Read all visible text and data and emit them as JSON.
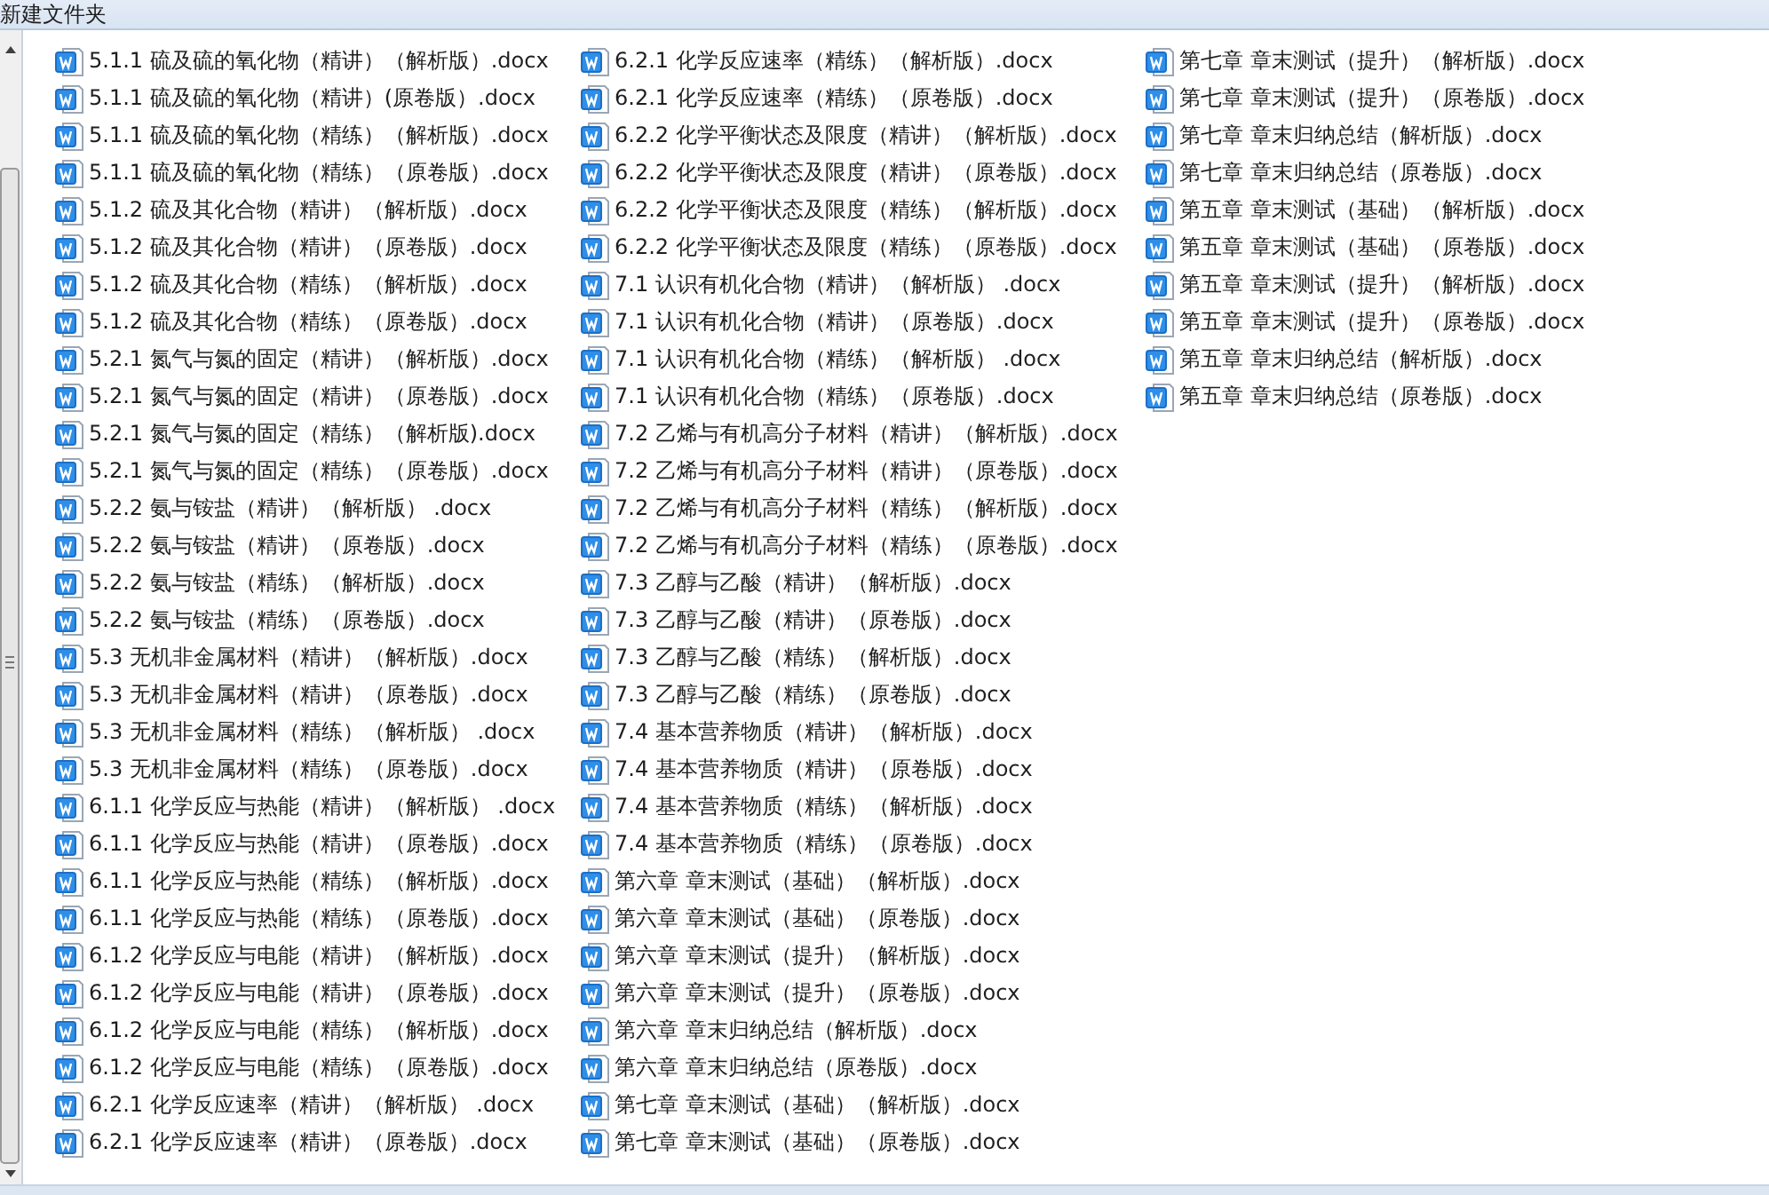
{
  "window": {
    "title": "新建文件夹"
  },
  "files": [
    {
      "name": "5.1.1 硫及硫的氧化物（精讲）（解析版）.docx"
    },
    {
      "name": "5.1.1 硫及硫的氧化物（精讲）(原卷版）.docx"
    },
    {
      "name": "5.1.1 硫及硫的氧化物（精练）（解析版）.docx"
    },
    {
      "name": "5.1.1 硫及硫的氧化物（精练）（原卷版）.docx"
    },
    {
      "name": "5.1.2 硫及其化合物（精讲）（解析版）.docx"
    },
    {
      "name": "5.1.2 硫及其化合物（精讲）（原卷版）.docx"
    },
    {
      "name": "5.1.2 硫及其化合物（精练）（解析版）.docx"
    },
    {
      "name": "5.1.2 硫及其化合物（精练）（原卷版）.docx"
    },
    {
      "name": "5.2.1 氮气与氮的固定（精讲）（解析版）.docx"
    },
    {
      "name": "5.2.1 氮气与氮的固定（精讲）（原卷版）.docx"
    },
    {
      "name": "5.2.1 氮气与氮的固定（精练）（解析版).docx"
    },
    {
      "name": "5.2.1 氮气与氮的固定（精练）（原卷版）.docx"
    },
    {
      "name": "5.2.2 氨与铵盐（精讲）（解析版） .docx"
    },
    {
      "name": "5.2.2 氨与铵盐（精讲）（原卷版）.docx"
    },
    {
      "name": "5.2.2 氨与铵盐（精练）（解析版）.docx"
    },
    {
      "name": "5.2.2 氨与铵盐（精练）（原卷版）.docx"
    },
    {
      "name": "5.3 无机非金属材料（精讲）（解析版）.docx"
    },
    {
      "name": "5.3 无机非金属材料（精讲）（原卷版）.docx"
    },
    {
      "name": "5.3 无机非金属材料（精练）（解析版） .docx"
    },
    {
      "name": "5.3 无机非金属材料（精练）（原卷版）.docx"
    },
    {
      "name": "6.1.1 化学反应与热能（精讲）（解析版） .docx"
    },
    {
      "name": "6.1.1 化学反应与热能（精讲）（原卷版）.docx"
    },
    {
      "name": "6.1.1 化学反应与热能（精练）（解析版）.docx"
    },
    {
      "name": "6.1.1 化学反应与热能（精练）（原卷版）.docx"
    },
    {
      "name": "6.1.2 化学反应与电能（精讲）（解析版）.docx"
    },
    {
      "name": "6.1.2 化学反应与电能（精讲）（原卷版）.docx"
    },
    {
      "name": "6.1.2 化学反应与电能（精练）（解析版）.docx"
    },
    {
      "name": "6.1.2 化学反应与电能（精练）（原卷版）.docx"
    },
    {
      "name": "6.2.1 化学反应速率（精讲）（解析版） .docx"
    },
    {
      "name": "6.2.1 化学反应速率（精讲）（原卷版）.docx"
    },
    {
      "name": "6.2.1 化学反应速率（精练）（解析版）.docx"
    },
    {
      "name": "6.2.1 化学反应速率（精练）（原卷版）.docx"
    },
    {
      "name": "6.2.2 化学平衡状态及限度（精讲）（解析版）.docx"
    },
    {
      "name": "6.2.2 化学平衡状态及限度（精讲）（原卷版）.docx"
    },
    {
      "name": "6.2.2 化学平衡状态及限度（精练）（解析版）.docx"
    },
    {
      "name": "6.2.2 化学平衡状态及限度（精练）（原卷版）.docx"
    },
    {
      "name": "7.1 认识有机化合物（精讲）（解析版） .docx"
    },
    {
      "name": "7.1 认识有机化合物（精讲）（原卷版）.docx"
    },
    {
      "name": "7.1 认识有机化合物（精练）（解析版） .docx"
    },
    {
      "name": "7.1 认识有机化合物（精练）（原卷版）.docx"
    },
    {
      "name": "7.2 乙烯与有机高分子材料（精讲）（解析版）.docx"
    },
    {
      "name": "7.2 乙烯与有机高分子材料（精讲）（原卷版）.docx"
    },
    {
      "name": "7.2 乙烯与有机高分子材料（精练）（解析版）.docx"
    },
    {
      "name": "7.2 乙烯与有机高分子材料（精练）（原卷版）.docx"
    },
    {
      "name": "7.3 乙醇与乙酸（精讲）（解析版）.docx"
    },
    {
      "name": "7.3 乙醇与乙酸（精讲）（原卷版）.docx"
    },
    {
      "name": "7.3 乙醇与乙酸（精练）（解析版）.docx"
    },
    {
      "name": "7.3 乙醇与乙酸（精练）（原卷版）.docx"
    },
    {
      "name": "7.4 基本营养物质（精讲）（解析版）.docx"
    },
    {
      "name": "7.4 基本营养物质（精讲）（原卷版）.docx"
    },
    {
      "name": "7.4 基本营养物质（精练）（解析版）.docx"
    },
    {
      "name": "7.4 基本营养物质（精练）（原卷版）.docx"
    },
    {
      "name": "第六章 章末测试（基础）（解析版）.docx"
    },
    {
      "name": "第六章 章末测试（基础）（原卷版）.docx"
    },
    {
      "name": "第六章 章末测试（提升）（解析版）.docx"
    },
    {
      "name": "第六章 章末测试（提升）（原卷版）.docx"
    },
    {
      "name": "第六章 章末归纳总结（解析版）.docx"
    },
    {
      "name": "第六章 章末归纳总结（原卷版）.docx"
    },
    {
      "name": "第七章 章末测试（基础）（解析版）.docx"
    },
    {
      "name": "第七章 章末测试（基础）（原卷版）.docx"
    },
    {
      "name": "第七章 章末测试（提升）（解析版）.docx"
    },
    {
      "name": "第七章 章末测试（提升）（原卷版）.docx"
    },
    {
      "name": "第七章 章末归纳总结（解析版）.docx"
    },
    {
      "name": "第七章 章末归纳总结（原卷版）.docx"
    },
    {
      "name": "第五章 章末测试（基础）（解析版）.docx"
    },
    {
      "name": "第五章 章末测试（基础）（原卷版）.docx"
    },
    {
      "name": "第五章 章末测试（提升）（解析版）.docx"
    },
    {
      "name": "第五章 章末测试（提升）（原卷版）.docx"
    },
    {
      "name": "第五章 章末归纳总结（解析版）.docx"
    },
    {
      "name": "第五章 章末归纳总结（原卷版）.docx"
    }
  ]
}
